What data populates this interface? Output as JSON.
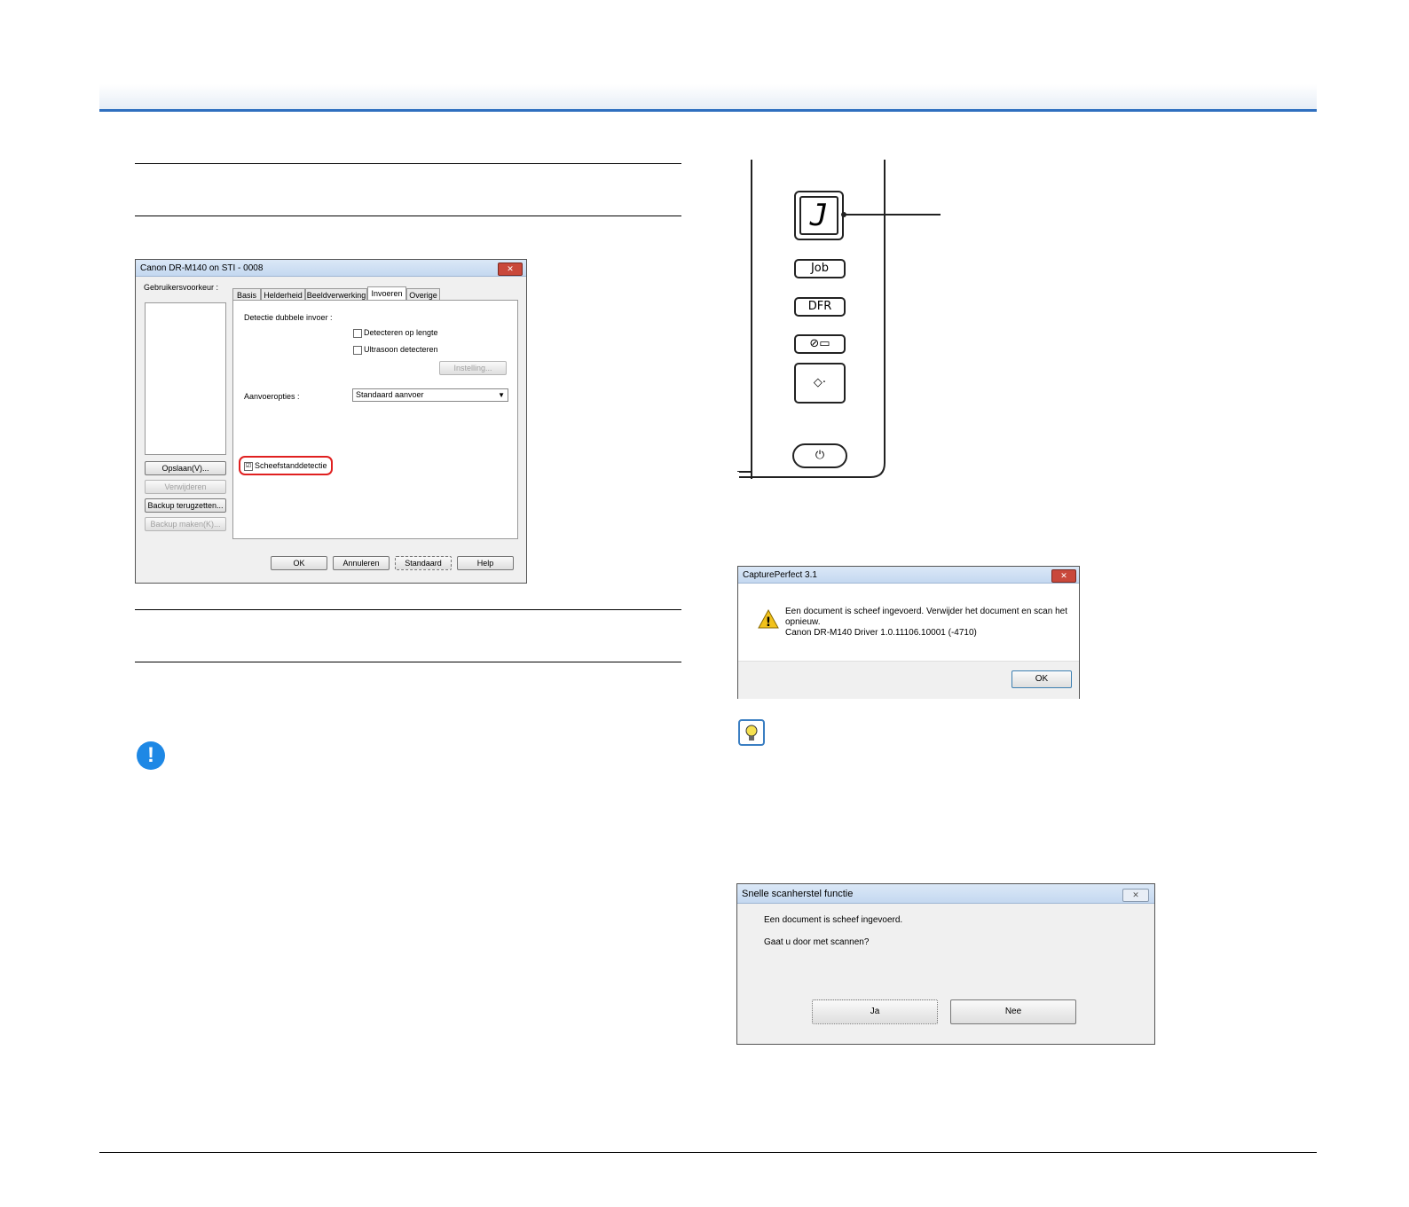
{
  "settings_dialog": {
    "title": "Canon DR-M140 on STI - 0008",
    "close_label": "✕",
    "user_pref_label": "Gebruikersvoorkeur :",
    "tabs": [
      "Basis",
      "Helderheid",
      "Beeldverwerking",
      "Invoeren",
      "Overige"
    ],
    "active_tab": "Invoeren",
    "double_feed_label": "Detectie dubbele invoer :",
    "detect_length_label": "Detecteren op lengte",
    "ultrasonic_label": "Ultrasoon detecteren",
    "settings_button": "Instelling...",
    "feed_options_label": "Aanvoeropties :",
    "feed_option_value": "Standaard aanvoer",
    "skew_label": "Scheefstanddetectie",
    "skew_check": "☑",
    "save_button": "Opslaan(V)...",
    "delete_button": "Verwijderen",
    "restore_button": "Backup terugzetten...",
    "backup_button": "Backup maken(K)...",
    "ok_button": "OK",
    "cancel_button": "Annuleren",
    "default_button": "Standaard",
    "help_button": "Help"
  },
  "scanner_panel": {
    "display_char": "J",
    "job_label": "Job",
    "dfr_label": "DFR",
    "stop_icon": "stop-icon",
    "start_icon": "start-icon",
    "power_icon": "power-icon"
  },
  "error_dialog": {
    "title": "CapturePerfect 3.1",
    "message_line1": "Een document is scheef ingevoerd. Verwijder het document en scan het",
    "message_line2": "opnieuw.",
    "message_line3": "Canon DR-M140 Driver 1.0.11106.10001 (-4710)",
    "ok_button": "OK"
  },
  "quick_recovery_dialog": {
    "title": "Snelle scanherstel functie",
    "close_label": "✕",
    "line1": "Een document is scheef ingevoerd.",
    "line2": "Gaat u door met scannen?",
    "yes_button": "Ja",
    "no_button": "Nee"
  },
  "icons": {
    "important": "!",
    "hint": "lightbulb-icon",
    "warning": "!"
  },
  "colors": {
    "accent_blue": "#2f6fbf",
    "important_blue": "#1e88e5",
    "highlight_red": "#e02020"
  }
}
